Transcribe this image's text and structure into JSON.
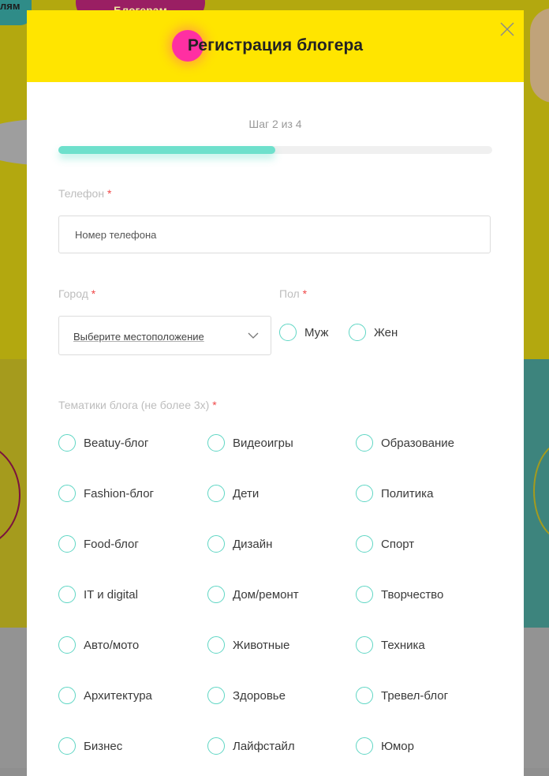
{
  "background": {
    "top_text": "лям",
    "pill_text": "Блогерам"
  },
  "modal": {
    "title": "Регистрация блогера",
    "step_label": "Шаг 2 из 4",
    "progress": 0.5,
    "phone": {
      "label": "Телефон",
      "required_mark": "*",
      "placeholder": "Номер телефона",
      "value": ""
    },
    "city": {
      "label": "Город",
      "required_mark": "*",
      "selected": "Выберите местоположение"
    },
    "gender": {
      "label": "Пол",
      "required_mark": "*",
      "options": [
        "Муж",
        "Жен"
      ]
    },
    "topics": {
      "label": "Тематики блога (не более 3х)",
      "required_mark": "*",
      "columns": [
        [
          "Beatuy-блог",
          "Fashion-блог",
          "Food-блог",
          "IT и digital",
          "Авто/мото",
          "Архитектура",
          "Бизнес"
        ],
        [
          "Видеоигры",
          "Дети",
          "Дизайн",
          "Дом/ремонт",
          "Животные",
          "Здоровье",
          "Лайфстайл"
        ],
        [
          "Образование",
          "Политика",
          "Спорт",
          "Творчество",
          "Техника",
          "Тревел-блог",
          "Юмор"
        ]
      ]
    }
  },
  "colors": {
    "header": "#ffe500",
    "accent_pink": "#ff2fa2",
    "progress": "#6ee0cc",
    "radio_border": "#5fd6c4",
    "required": "#f04848"
  },
  "icons": {
    "close": "close-icon",
    "dropdown": "chevron-down-icon"
  }
}
